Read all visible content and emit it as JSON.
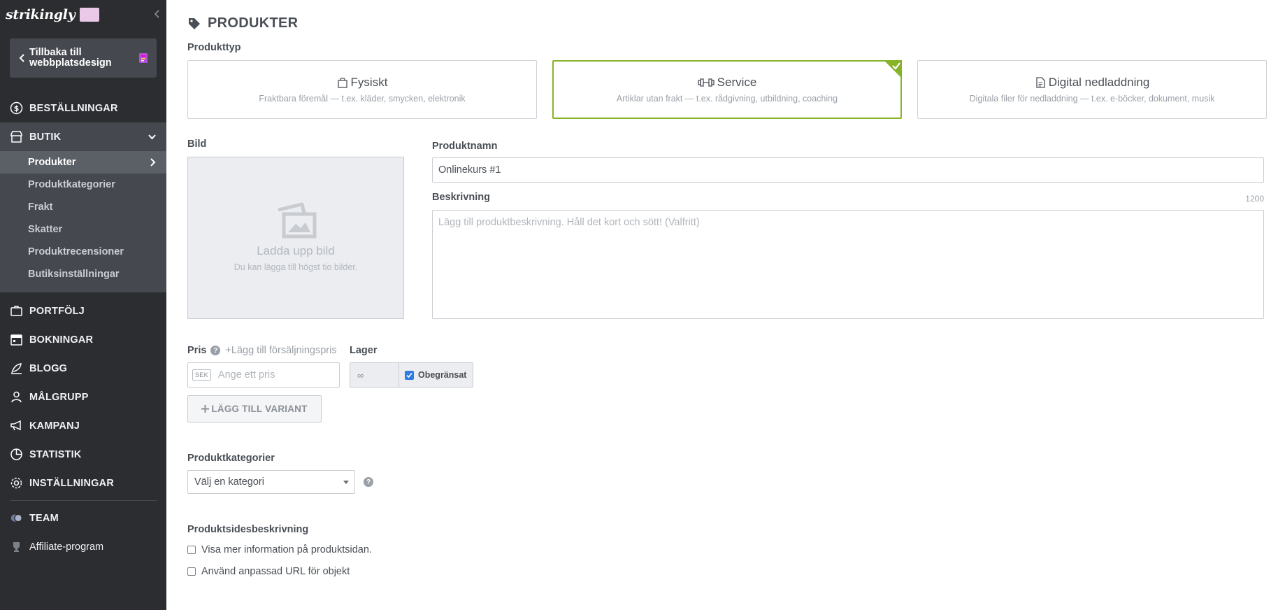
{
  "sidebar": {
    "logo": "strikingly",
    "back_label": "Tillbaka till webbplatsdesign",
    "nav": {
      "orders": "BESTÄLLNINGAR",
      "store": "BUTIK",
      "portfolio": "PORTFÖLJ",
      "bookings": "BOKNINGAR",
      "blog": "BLOGG",
      "audience": "MÅLGRUPP",
      "campaign": "KAMPANJ",
      "stats": "STATISTIK",
      "settings": "INSTÄLLNINGAR",
      "team": "TEAM",
      "affiliate": "Affiliate-program"
    },
    "store_sub": {
      "products": "Produkter",
      "categories": "Produktkategorier",
      "shipping": "Frakt",
      "taxes": "Skatter",
      "reviews": "Produktrecensioner",
      "store_settings": "Butiksinställningar"
    }
  },
  "page": {
    "title": "PRODUKTER",
    "product_type_label": "Produkttyp",
    "types": {
      "physical": {
        "title": "Fysiskt",
        "sub": "Fraktbara föremål — t.ex. kläder, smycken, elektronik"
      },
      "service": {
        "title": "Service",
        "sub": "Artiklar utan frakt — t.ex. rådgivning, utbildning, coaching"
      },
      "digital": {
        "title": "Digital nedladdning",
        "sub": "Digitala filer för nedladdning — t.ex. e-böcker, dokument, musik"
      }
    },
    "selected_type": "service",
    "image_label": "Bild",
    "upload_title": "Ladda upp bild",
    "upload_sub": "Du kan lägga till högst tio bilder.",
    "name_label": "Produktnamn",
    "name_value": "Onlinekurs #1",
    "desc_label": "Beskrivning",
    "desc_counter": "1200",
    "desc_placeholder": "Lägg till produktbeskrivning. Håll det kort och sött! (Valfritt)",
    "price_label": "Pris",
    "price_help": "?",
    "add_sale_price": "+Lägg till försäljningspris",
    "currency": "SEK",
    "price_placeholder": "Ange ett pris",
    "stock_label": "Lager",
    "stock_value": "∞",
    "unlimited_label": "Obegränsat",
    "unlimited_checked": true,
    "add_variant": "LÄGG TILL VARIANT",
    "categories_label": "Produktkategorier",
    "category_select": "Välj en kategori",
    "category_help": "?",
    "page_desc_label": "Produktsidesbeskrivning",
    "opt_more_info": "Visa mer information på produktsidan.",
    "opt_custom_url": "Använd anpassad URL för objekt"
  },
  "colors": {
    "sidebar_bg": "#2c2d30",
    "sidebar_active": "#45484e",
    "accent_green": "#87b32a",
    "checkbox_blue": "#2f7de1"
  }
}
